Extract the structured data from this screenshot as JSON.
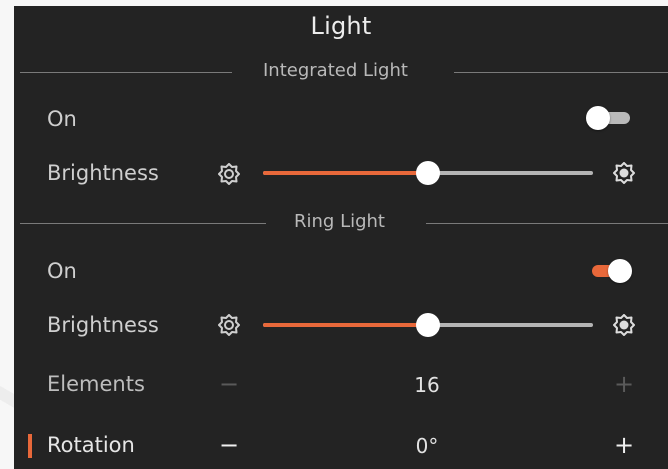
{
  "title": "Light",
  "colors": {
    "accent": "#e8683a",
    "rail": "#b4b4b4",
    "toggle_off_track": "#b9b9b9",
    "disabled": "#5a5a5a"
  },
  "integrated_light": {
    "section_label": "Integrated Light",
    "on_label": "On",
    "on_state": false,
    "brightness_label": "Brightness",
    "brightness_fraction": 0.5,
    "brightness_min_icon": "brightness-low-icon",
    "brightness_max_icon": "brightness-high-icon"
  },
  "ring_light": {
    "section_label": "Ring Light",
    "on_label": "On",
    "on_state": true,
    "brightness_label": "Brightness",
    "brightness_fraction": 0.5,
    "brightness_min_icon": "brightness-low-icon",
    "brightness_max_icon": "brightness-high-icon",
    "elements_label": "Elements",
    "elements_value": "16",
    "elements_decrement": "−",
    "elements_increment": "+",
    "rotation_label": "Rotation",
    "rotation_value": "0°",
    "rotation_decrement": "−",
    "rotation_increment": "+"
  }
}
